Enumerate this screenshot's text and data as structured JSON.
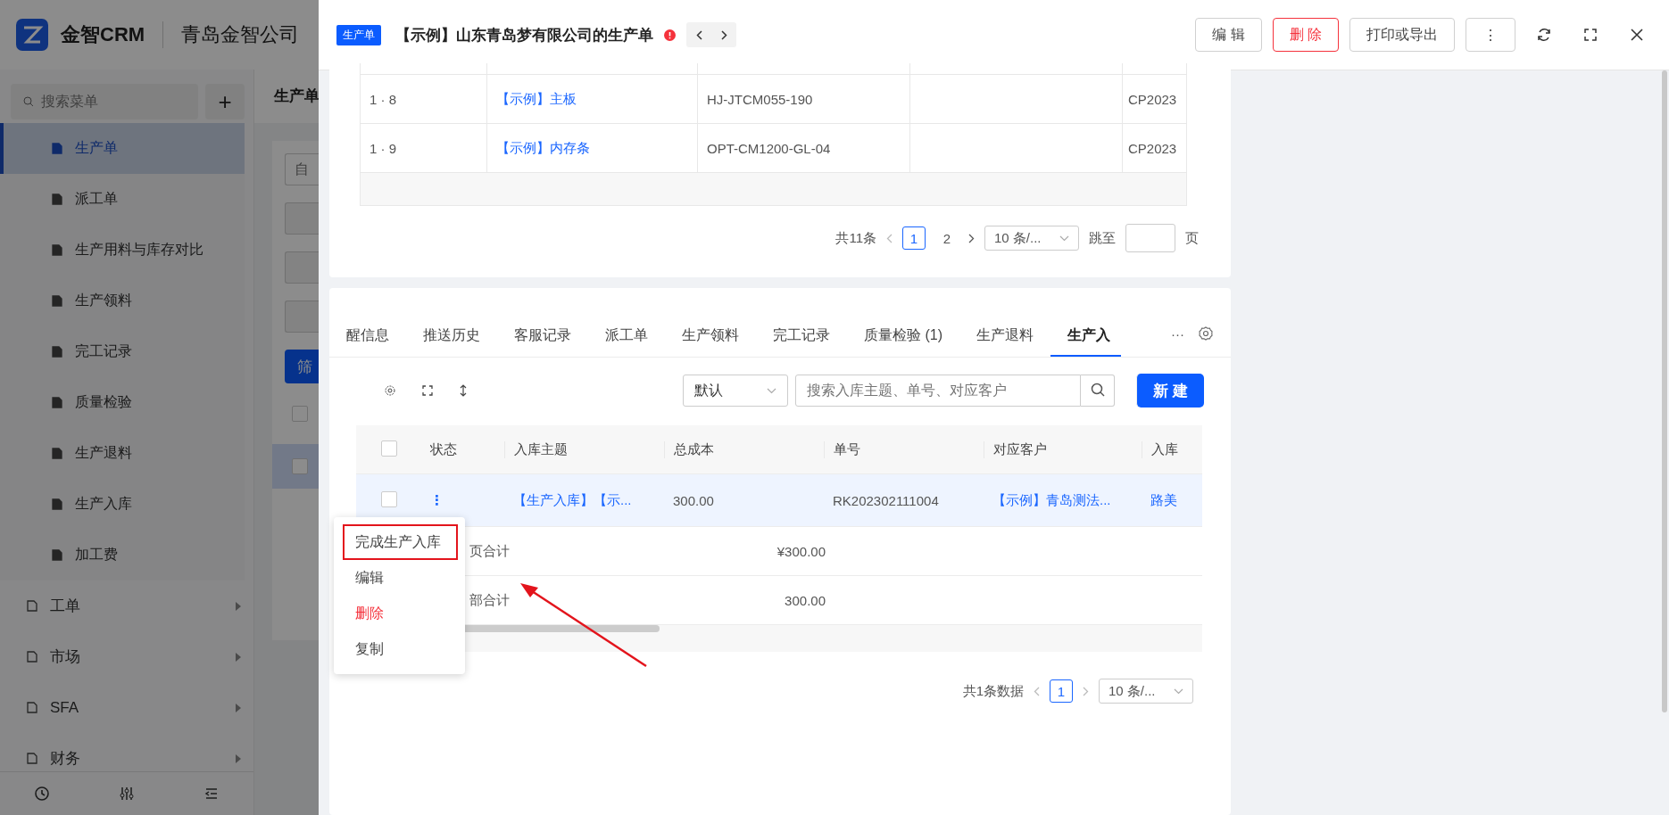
{
  "app": {
    "logo_text": "金智CRM",
    "company": "青岛金智公司",
    "search": {
      "placeholder": "搜索菜单"
    },
    "add_button": "+",
    "menu": [
      {
        "label": "生产单",
        "kind": "sub",
        "selected": true
      },
      {
        "label": "派工单",
        "kind": "sub",
        "selected": false
      },
      {
        "label": "生产用料与库存对比",
        "kind": "sub",
        "selected": false
      },
      {
        "label": "生产领料",
        "kind": "sub",
        "selected": false
      },
      {
        "label": "完工记录",
        "kind": "sub",
        "selected": false
      },
      {
        "label": "质量检验",
        "kind": "sub",
        "selected": false
      },
      {
        "label": "生产退料",
        "kind": "sub",
        "selected": false
      },
      {
        "label": "生产入库",
        "kind": "sub",
        "selected": false
      },
      {
        "label": "加工费",
        "kind": "sub",
        "selected": false
      },
      {
        "label": "工单",
        "kind": "group",
        "selected": false
      },
      {
        "label": "市场",
        "kind": "group",
        "selected": false
      },
      {
        "label": "SFA",
        "kind": "group",
        "selected": false
      },
      {
        "label": "财务",
        "kind": "group",
        "selected": false
      }
    ],
    "page_title": "生产单",
    "filter_placeholder": "自",
    "filter_button": "筛",
    "list_rows": [
      {
        "checked": false,
        "selected": false
      },
      {
        "checked": false,
        "selected": true
      }
    ]
  },
  "drawer": {
    "badge": "生产单",
    "title": "【示例】山东青岛梦有限公司的生产单",
    "buttons": [
      {
        "label": "编 辑",
        "kind": "default"
      },
      {
        "label": "删 除",
        "kind": "danger"
      },
      {
        "label": "打印或导出",
        "kind": "default"
      },
      {
        "label": "⋮",
        "kind": "more"
      }
    ],
    "detail_table": {
      "rows": [
        [
          "1 · 8",
          "【示例】主板",
          "HJ-JTCM055-190",
          "",
          "CP2023"
        ],
        [
          "1 · 9",
          "【示例】内存条",
          "OPT-CM1200-GL-04",
          "",
          "CP2023"
        ]
      ]
    },
    "detail_pagination": {
      "total": "共11条",
      "pages": [
        {
          "label": "1",
          "selected": true
        },
        {
          "label": "2",
          "selected": false
        }
      ],
      "page_size": "10 条/...",
      "jump_label": "跳至",
      "jump_suffix": "页"
    },
    "tabs": [
      {
        "label": "醒信息",
        "selected": false
      },
      {
        "label": "推送历史",
        "selected": false
      },
      {
        "label": "客服记录",
        "selected": false
      },
      {
        "label": "派工单",
        "selected": false
      },
      {
        "label": "生产领料",
        "selected": false
      },
      {
        "label": "完工记录",
        "selected": false
      },
      {
        "label": "质量检验 (1)",
        "selected": false
      },
      {
        "label": "生产退料",
        "selected": false
      },
      {
        "label": "生产入",
        "selected": true
      }
    ],
    "tabs_more": "···",
    "view_select": "默认",
    "search": {
      "placeholder": "搜索入库主题、单号、对应客户"
    },
    "new_button": "新 建",
    "table": {
      "columns": [
        "状态",
        "入库主题",
        "总成本",
        "单号",
        "对应客户",
        "入库"
      ],
      "rows": [
        {
          "checked": false,
          "cells": [
            "⋮",
            "【生产入库】【示...",
            "300.00",
            "RK202302111004",
            "【示例】青岛测法...",
            "路美"
          ]
        }
      ],
      "header_checked": false,
      "summaries": [
        {
          "label": "页合计",
          "value": "¥300.00"
        },
        {
          "label": "部合计",
          "value": "300.00"
        }
      ]
    },
    "pagination": {
      "total": "共1条数据",
      "pages": [
        {
          "label": "1",
          "selected": true
        }
      ],
      "page_size": "10 条/..."
    },
    "context_menu": [
      {
        "label": "完成生产入库",
        "kind": "highlighted"
      },
      {
        "label": "编辑",
        "kind": "normal"
      },
      {
        "label": "删除",
        "kind": "danger"
      },
      {
        "label": "复制",
        "kind": "normal"
      }
    ]
  }
}
